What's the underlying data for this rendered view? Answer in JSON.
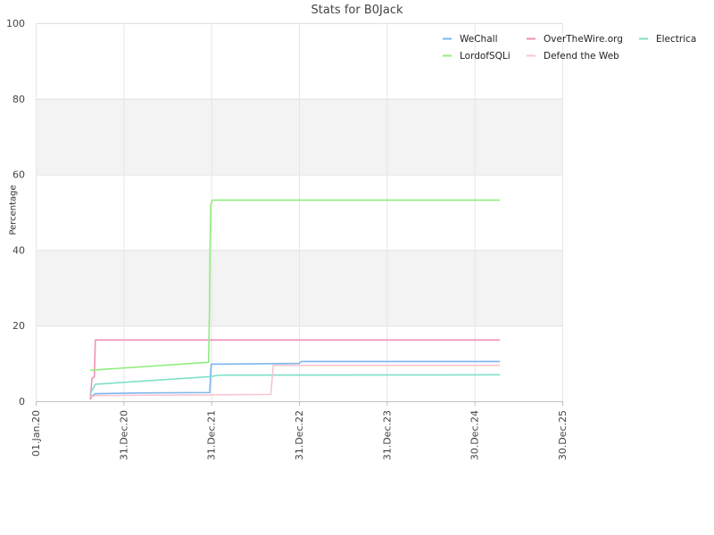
{
  "chart_data": {
    "type": "line",
    "title": "Stats for B0Jack",
    "ylabel": "Percentage",
    "xlabel": "",
    "ylim": [
      0,
      100
    ],
    "y_ticks": [
      0,
      20,
      40,
      60,
      80,
      100
    ],
    "xlim": [
      "2020-01-01",
      "2025-12-30"
    ],
    "x_ticks": [
      {
        "date": "2020-01-01",
        "label": "01.Jan.20"
      },
      {
        "date": "2020-12-31",
        "label": "31.Dec.20"
      },
      {
        "date": "2021-12-31",
        "label": "31.Dec.21"
      },
      {
        "date": "2022-12-31",
        "label": "31.Dec.22"
      },
      {
        "date": "2023-12-31",
        "label": "31.Dec.23"
      },
      {
        "date": "2024-12-30",
        "label": "30.Dec.24"
      },
      {
        "date": "2025-12-30",
        "label": "30.Dec.25"
      }
    ],
    "grid": true,
    "alternating_bands": true,
    "legend_position": "top-right",
    "series": [
      {
        "name": "WeChall",
        "color": "#7cb5ec",
        "points": [
          [
            "2020-08-15",
            0.5
          ],
          [
            "2020-08-25",
            1.5
          ],
          [
            "2020-09-05",
            2.0
          ],
          [
            "2021-04-01",
            2.2
          ],
          [
            "2021-12-25",
            2.3
          ],
          [
            "2021-12-28",
            7.0
          ],
          [
            "2021-12-31",
            9.8
          ],
          [
            "2022-12-31",
            10.0
          ],
          [
            "2023-01-10",
            10.5
          ],
          [
            "2025-04-15",
            10.5
          ]
        ]
      },
      {
        "name": "OverTheWire.org",
        "color": "#f28fb8",
        "points": [
          [
            "2020-08-15",
            0.5
          ],
          [
            "2020-08-22",
            6.0
          ],
          [
            "2020-09-01",
            6.5
          ],
          [
            "2020-09-05",
            16.2
          ],
          [
            "2025-04-15",
            16.2
          ]
        ]
      },
      {
        "name": "Electrica",
        "color": "#7ee0c8",
        "points": [
          [
            "2020-08-15",
            2.0
          ],
          [
            "2020-09-05",
            4.5
          ],
          [
            "2021-12-25",
            6.5
          ],
          [
            "2022-02-01",
            6.9
          ],
          [
            "2025-04-15",
            7.0
          ]
        ]
      },
      {
        "name": "LordofSQLi",
        "color": "#90ed7d",
        "points": [
          [
            "2020-08-15",
            8.2
          ],
          [
            "2021-12-20",
            10.3
          ],
          [
            "2021-12-24",
            25.0
          ],
          [
            "2021-12-26",
            40.0
          ],
          [
            "2021-12-29",
            52.0
          ],
          [
            "2022-01-05",
            53.2
          ],
          [
            "2025-04-15",
            53.2
          ]
        ]
      },
      {
        "name": "Defend the Web",
        "color": "#f7c5cf",
        "points": [
          [
            "2020-08-15",
            1.0
          ],
          [
            "2020-09-05",
            1.5
          ],
          [
            "2022-09-05",
            1.8
          ],
          [
            "2022-09-15",
            9.5
          ],
          [
            "2025-04-15",
            9.5
          ]
        ]
      }
    ]
  }
}
